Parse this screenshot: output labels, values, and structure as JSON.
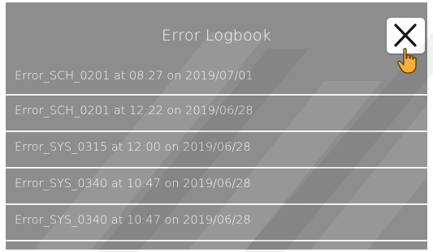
{
  "dialog": {
    "title": "Error Logbook",
    "close_icon": "close-icon",
    "cursor_icon": "hand-pointer-icon"
  },
  "errors": [
    {
      "label": "Error_SCH_0201 at 08:27 on 2019/07/01"
    },
    {
      "label": "Error_SCH_0201 at 12:22 on 2019/06/28"
    },
    {
      "label": "Error_SYS_0315 at 12:00 on 2019/06/28"
    },
    {
      "label": "Error_SYS_0340 at 10:47 on 2019/06/28"
    },
    {
      "label": "Error_SYS_0340 at 10:47 on 2019/06/28"
    }
  ],
  "colors": {
    "panel": "#8d8d8d",
    "text": "#f5f5f5",
    "divider": "#f2f2f2",
    "close_button": "#ffffff"
  }
}
